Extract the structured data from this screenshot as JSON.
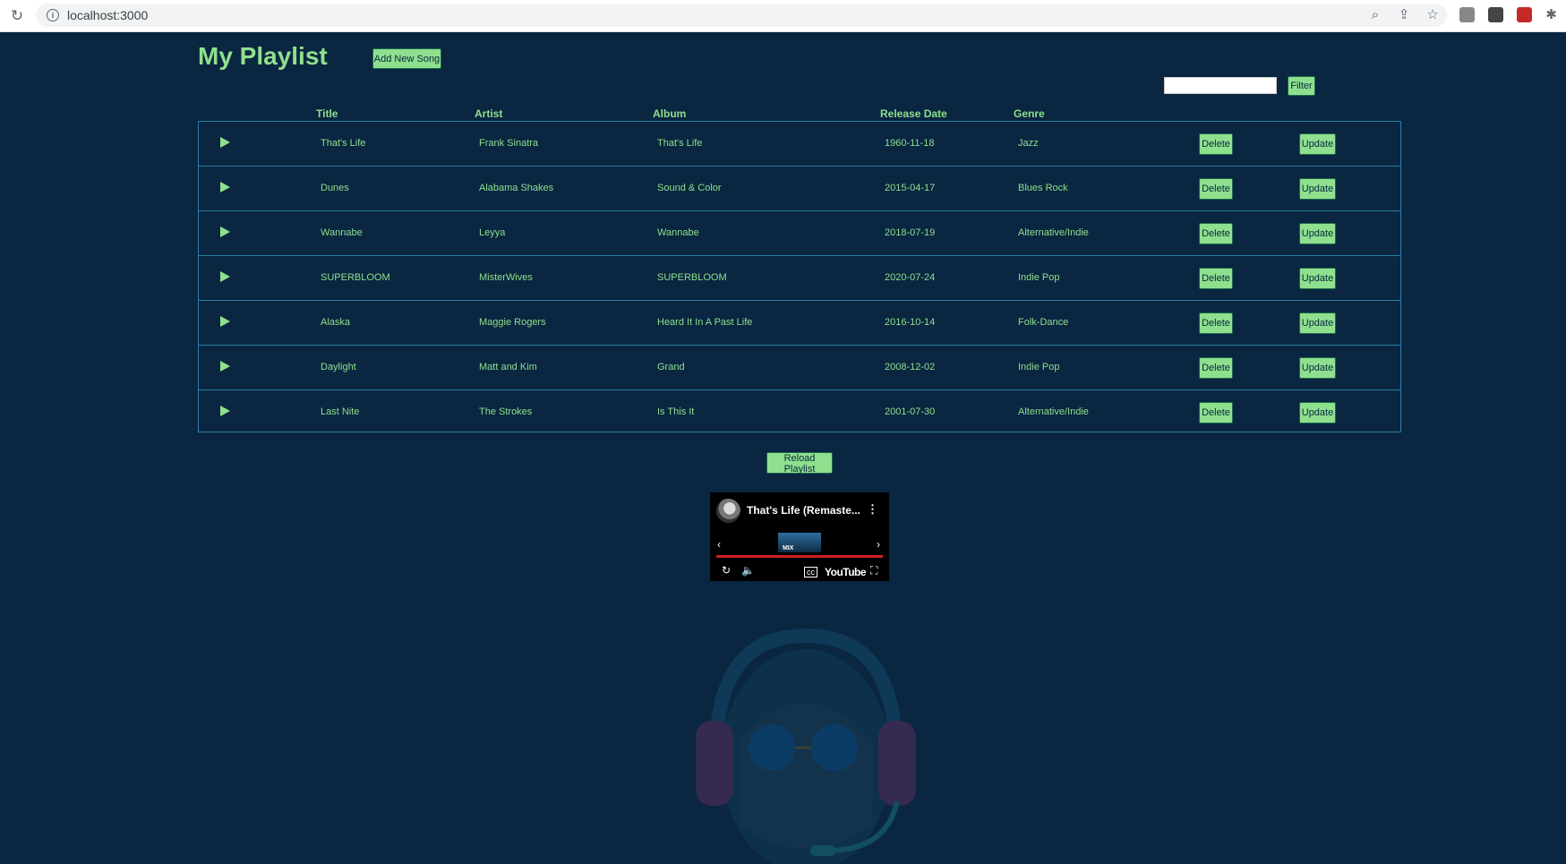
{
  "browser": {
    "url": "localhost:3000"
  },
  "page": {
    "title": "My Playlist",
    "add_button": "Add New Song",
    "filter_button": "Filter",
    "filter_value": "",
    "reload_button": "Reload Playlist"
  },
  "table": {
    "headers": {
      "title": "Title",
      "artist": "Artist",
      "album": "Album",
      "release": "Release Date",
      "genre": "Genre"
    },
    "delete_label": "Delete",
    "update_label": "Update",
    "rows": [
      {
        "title": "That's Life",
        "artist": "Frank Sinatra",
        "album": "That's Life",
        "release": "1960-11-18",
        "genre": "Jazz"
      },
      {
        "title": "Dunes",
        "artist": "Alabama Shakes",
        "album": "Sound & Color",
        "release": "2015-04-17",
        "genre": "Blues Rock"
      },
      {
        "title": "Wannabe",
        "artist": "Leyya",
        "album": "Wannabe",
        "release": "2018-07-19",
        "genre": "Alternative/Indie"
      },
      {
        "title": "SUPERBLOOM",
        "artist": "MisterWives",
        "album": "SUPERBLOOM",
        "release": "2020-07-24",
        "genre": "Indie Pop"
      },
      {
        "title": "Alaska",
        "artist": "Maggie Rogers",
        "album": "Heard It In A Past Life",
        "release": "2016-10-14",
        "genre": "Folk-Dance"
      },
      {
        "title": "Daylight",
        "artist": "Matt and Kim",
        "album": "Grand",
        "release": "2008-12-02",
        "genre": "Indie Pop"
      },
      {
        "title": "Last Nite",
        "artist": "The Strokes",
        "album": "Is This It",
        "release": "2001-07-30",
        "genre": "Alternative/Indie"
      }
    ]
  },
  "player": {
    "title": "That's Life (Remaste...",
    "mix_label": "MIX",
    "logo": "YouTube"
  },
  "colors": {
    "background": "#0a2640",
    "accent": "#8ee08e",
    "border": "#2a7fa8"
  }
}
